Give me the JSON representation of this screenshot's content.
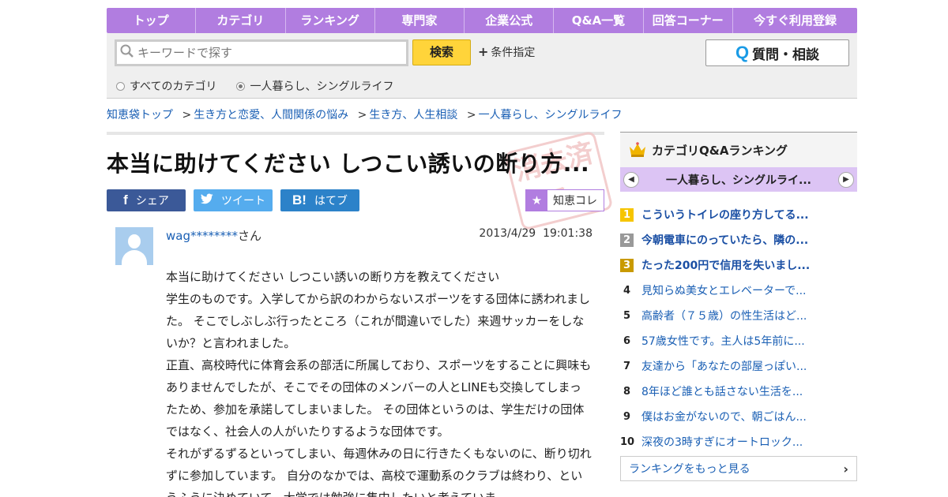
{
  "nav": [
    "トップ",
    "カテゴリ",
    "ランキング",
    "専門家",
    "企業公式",
    "Q&A一覧",
    "回答コーナー",
    "今すぐ利用登録"
  ],
  "search": {
    "placeholder": "キーワードで探す",
    "button": "検索",
    "conditions": "条件指定",
    "ask_button": "質問・相談",
    "ask_icon": "Q",
    "scope_all": "すべてのカテゴリ",
    "scope_current": "一人暮らし、シングルライフ",
    "selected_scope": "scope_current"
  },
  "breadcrumb": [
    "知恵袋トップ",
    "生き方と恋愛、人間関係の悩み",
    "生き方、人生相談",
    "一人暮らし、シングルライフ"
  ],
  "question": {
    "title": "本当に助けてください しつこい誘いの断り方...",
    "stamp_text": "消去済み",
    "user_masked": "wag********",
    "user_suffix": "さん",
    "date": "2013/4/29",
    "time": "19:01:38",
    "body": [
      "本当に助けてください しつこい誘いの断り方を教えてください",
      "学生のものです。入学してから訳のわからないスポーツをする団体に誘われました。 そこでしぶしぶ行ったところ（これが間違いでした）来週サッカーをしないか？と言われました。",
      "正直、高校時代に体育会系の部活に所属しており、スポーツをすることに興味もありませんでしたが、そこでその団体のメンバーの人とLINEも交換してしまったため、参加を承諾してしまいました。 その団体というのは、学生だけの団体ではなく、社会人の人がいたりするような団体です。",
      "それがずるずるといってしまい、毎週休みの日に行きたくもないのに、断り切れずに参加しています。 自分のなかでは、高校で運動系のクラブは終わり、というふうに決めていて、大学では勉強に集中したいと考えていま"
    ]
  },
  "share": {
    "facebook": "シェア",
    "twitter": "ツイート",
    "hatena": "はてブ",
    "hatena_icon": "B!",
    "chie_colle": "知恵コレ"
  },
  "ranking": {
    "title": "カテゴリQ&Aランキング",
    "category": "一人暮らし、シングルライ...",
    "items": [
      {
        "rank": "1",
        "text": "こういうトイレの座り方してる..."
      },
      {
        "rank": "2",
        "text": "今朝電車にのっていたら、隣の..."
      },
      {
        "rank": "3",
        "text": "たった200円で信用を失いまし..."
      },
      {
        "rank": "4",
        "text": "見知らぬ美女とエレベーターで..."
      },
      {
        "rank": "5",
        "text": "高齢者（７５歳）の性生活はど..."
      },
      {
        "rank": "6",
        "text": "57歳女性です。主人は5年前に..."
      },
      {
        "rank": "7",
        "text": "友達から「あなたの部屋っぽい..."
      },
      {
        "rank": "8",
        "text": "8年ほど誰とも話さない生活を..."
      },
      {
        "rank": "9",
        "text": "僕はお金がないので、朝ごはん..."
      },
      {
        "rank": "10",
        "text": "深夜の3時すぎにオートロック..."
      }
    ],
    "more": "ランキングをもっと見る"
  },
  "colors": {
    "accent": "#b17de0",
    "accent_light": "#dcc4f4",
    "link": "#1a5fb4",
    "search_button": "#ffd43a"
  }
}
